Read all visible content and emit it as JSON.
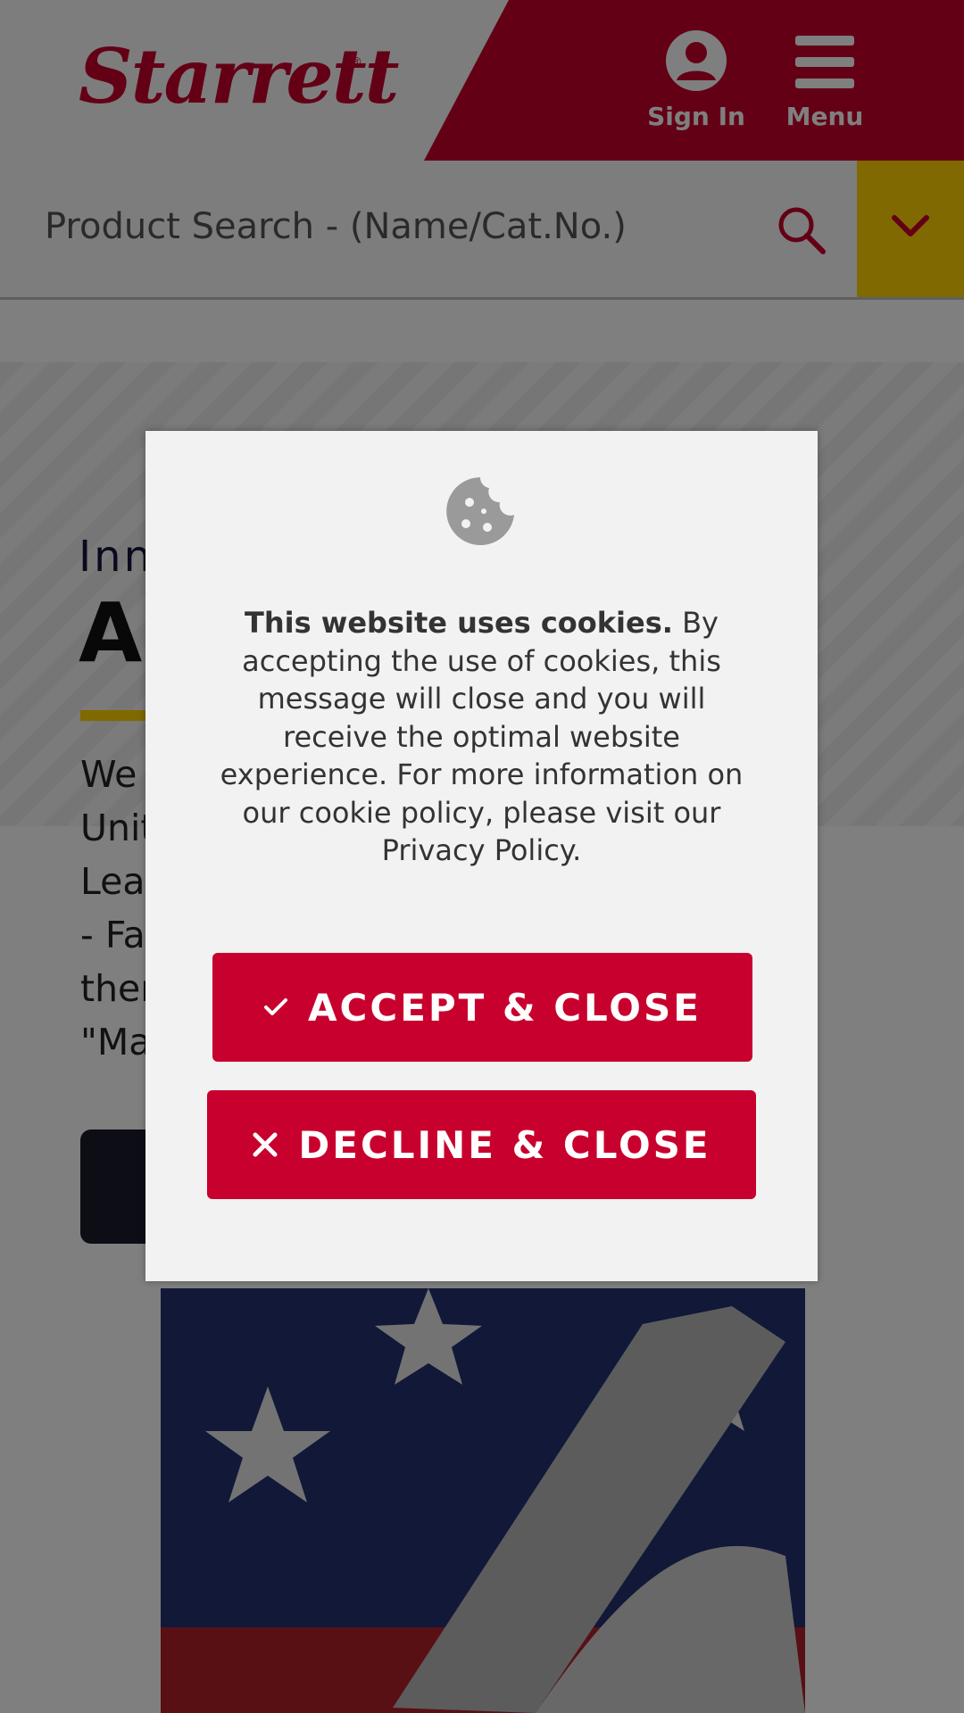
{
  "header": {
    "logo_text": "Starrett",
    "logo_mark": "®",
    "sign_in_label": "Sign In",
    "menu_label": "Menu",
    "brand_red": "#c8002d",
    "brand_yellow": "#ffd200"
  },
  "search": {
    "placeholder": "Product Search - (Name/Cat.No.)"
  },
  "hero": {
    "subtitle": "Inn",
    "title": "Al",
    "paragraph": "We\nUnit\nLea\n- Fa\nther\n\"Ma"
  },
  "cookie_modal": {
    "icon": "cookie-icon",
    "text_bold": "This website uses cookies.",
    "text_body": " By accepting the use of cookies, this message will close and you will receive the optimal website experience. For more information on our cookie policy, please visit our Privacy Policy.",
    "accept_label": "ACCEPT & CLOSE",
    "decline_label": "DECLINE & CLOSE"
  }
}
